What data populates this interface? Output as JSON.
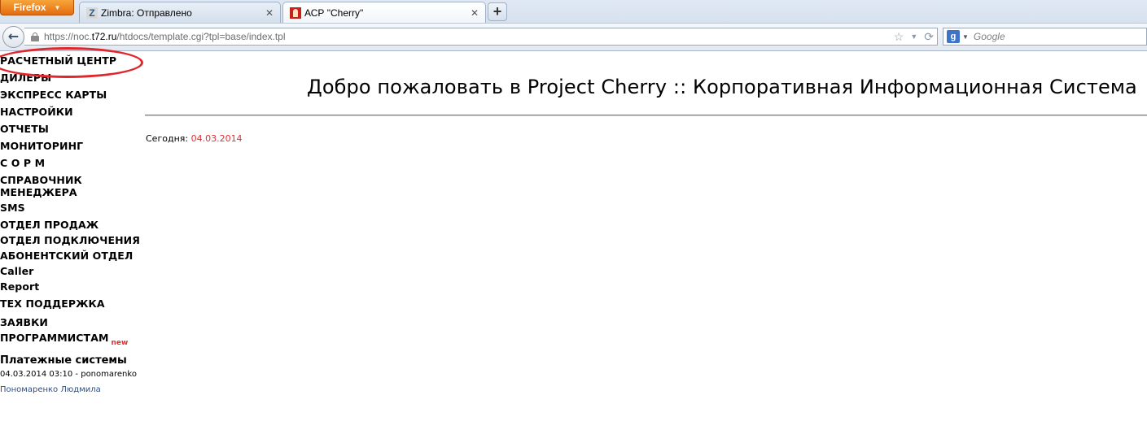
{
  "browser": {
    "menu_button": "Firefox",
    "tabs": [
      {
        "title": "Zimbra: Отправлено",
        "favicon": "zimbra-icon"
      },
      {
        "title": "АСР \"Cherry\"",
        "favicon": "cherry-icon"
      }
    ],
    "url_prefix": "https://noc.",
    "url_host": "t72.ru",
    "url_path": "/htdocs/template.cgi?tpl=base/index.tpl",
    "search_placeholder": "Google"
  },
  "sidebar": {
    "items": [
      "РАСЧЕТНЫЙ ЦЕНТР",
      "ДИЛЕРЫ",
      "ЭКСПРЕСС КАРТЫ",
      "НАСТРОЙКИ",
      "ОТЧЕТЫ",
      "МОНИТОРИНГ",
      "С О Р М",
      "СПРАВОЧНИК МЕНЕДЖЕРА",
      "SMS",
      "ОТДЕЛ ПРОДАЖ",
      "ОТДЕЛ ПОДКЛЮЧЕНИЯ",
      "АБОНЕНТСКИЙ ОТДЕЛ",
      "Caller",
      "Report",
      "ТЕХ ПОДДЕРЖКА",
      "ЗАЯВКИ ПРОГРАММИСТАМ"
    ],
    "new_badge": "new",
    "payments_heading": "Платежные системы",
    "log_line": "04.03.2014 03:10 - ponomarenko",
    "log_user": "Пономаренко Людмила"
  },
  "main": {
    "title": "Добро пожаловать в Project Cherry :: Корпоративная Информационная Система",
    "today_label": "Сегодня:",
    "today_date": "04.03.2014"
  },
  "colors": {
    "highlight": "#e0262b",
    "date": "#e03030",
    "link": "#2a4f8a"
  }
}
